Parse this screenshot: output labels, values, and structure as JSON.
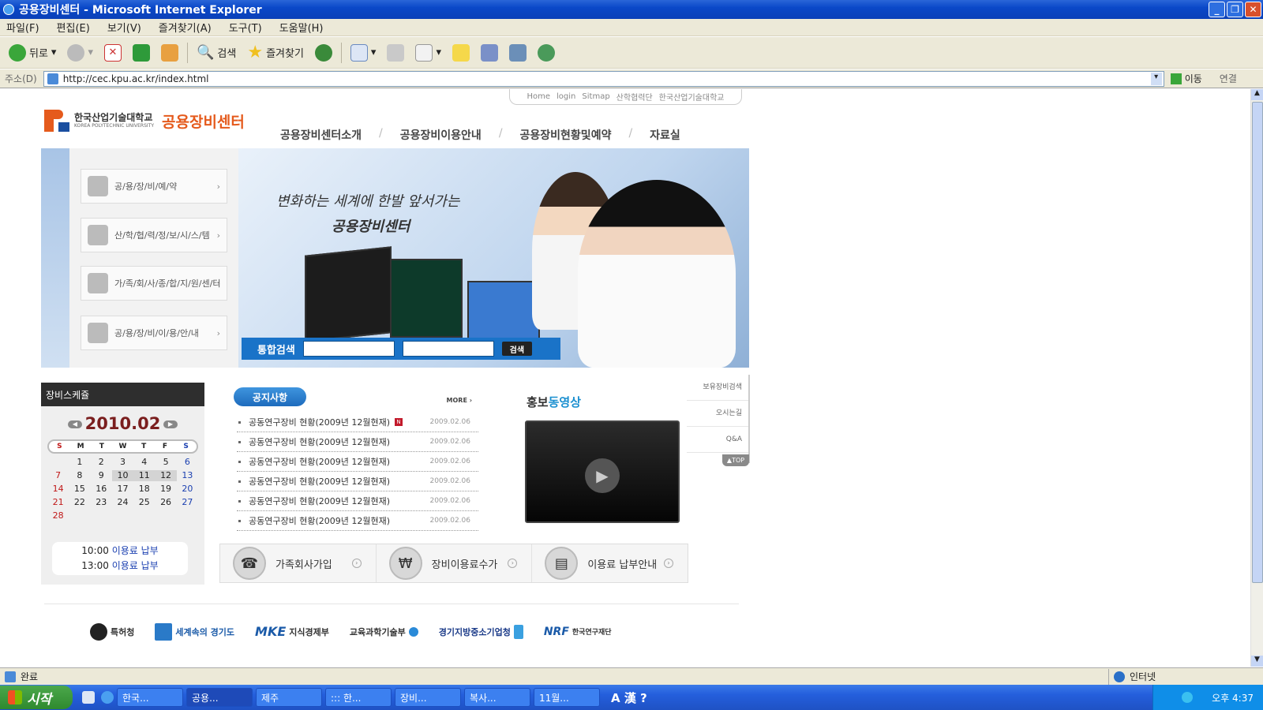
{
  "window": {
    "title": "공용장비센터 - Microsoft Internet Explorer"
  },
  "menu": [
    "파일(F)",
    "편집(E)",
    "보기(V)",
    "즐겨찾기(A)",
    "도구(T)",
    "도움말(H)"
  ],
  "toolbar": {
    "back": "뒤로",
    "search": "검색",
    "favorites": "즐겨찾기"
  },
  "address": {
    "label": "주소(D)",
    "url": "http://cec.kpu.ac.kr/index.html",
    "go": "이동",
    "links": "연결"
  },
  "top_links": [
    "Home",
    "login",
    "Sitmap",
    "산학협력단",
    "한국산업기술대학교"
  ],
  "logo": {
    "univ_kr": "한국산업기술대학교",
    "univ_en": "KOREA POLYTECHNIC UNIVERSITY",
    "center": "공용장비센터"
  },
  "main_nav": [
    "공용장비센터소개",
    "공용장비이용안내",
    "공용장비현황및예약",
    "자료실"
  ],
  "quick_menu": [
    "공/용/장/비/예/약",
    "산/학/협/력/정/보/시/스/템",
    "가/족/회/사/종/합/지/원/센/터",
    "공/용/장/비/이/용/안/내"
  ],
  "hero": {
    "line1": "변화하는 세계에 한발 앞서가는",
    "line2": "공용장비센터"
  },
  "search": {
    "label": "통합검색",
    "button": "검색"
  },
  "calendar": {
    "title": "장비스케쥴",
    "month": "2010.02",
    "dow": [
      "S",
      "M",
      "T",
      "W",
      "T",
      "F",
      "S"
    ],
    "days": [
      "",
      "1",
      "2",
      "3",
      "4",
      "5",
      "6",
      "7",
      "8",
      "9",
      "10",
      "11",
      "12",
      "13",
      "14",
      "15",
      "16",
      "17",
      "18",
      "19",
      "20",
      "21",
      "22",
      "23",
      "24",
      "25",
      "26",
      "27",
      "28"
    ],
    "schedule": [
      {
        "time": "10:00",
        "text": "이용료 납부"
      },
      {
        "time": "13:00",
        "text": "이용료 납부"
      }
    ]
  },
  "notices": {
    "title": "공지사항",
    "more": "MORE",
    "new_badge": "N",
    "items": [
      {
        "text": "공동연구장비 현황(2009년 12월현재)",
        "date": "2009.02.06"
      },
      {
        "text": "공동연구장비 현황(2009년 12월현재)",
        "date": "2009.02.06"
      },
      {
        "text": "공동연구장비 현황(2009년 12월현재)",
        "date": "2009.02.06"
      },
      {
        "text": "공동연구장비 현황(2009년 12월현재)",
        "date": "2009.02.06"
      },
      {
        "text": "공동연구장비 현황(2009년 12월현재)",
        "date": "2009.02.06"
      },
      {
        "text": "공동연구장비 현황(2009년 12월현재)",
        "date": "2009.02.06"
      }
    ]
  },
  "video": {
    "title_a": "홍보",
    "title_b": "동영상"
  },
  "side_links": [
    "보유장비검색",
    "오시는길",
    "Q&A"
  ],
  "top_btn": "TOP",
  "services": [
    "가족회사가입",
    "장비이용료수가",
    "이용료 납부안내"
  ],
  "partners": [
    "특허청",
    "세계속의 경기도",
    "지식경제부",
    "교육과학기술부",
    "경기지방중소기업청",
    "한국연구재단"
  ],
  "status": {
    "text": "완료",
    "zone": "인터넷"
  },
  "taskbar": {
    "start": "시작",
    "tasks": [
      "한국...",
      "공용...",
      "제주",
      "::: 한...",
      "장비...",
      "복사...",
      "11월..."
    ],
    "time": "오후 4:37"
  }
}
